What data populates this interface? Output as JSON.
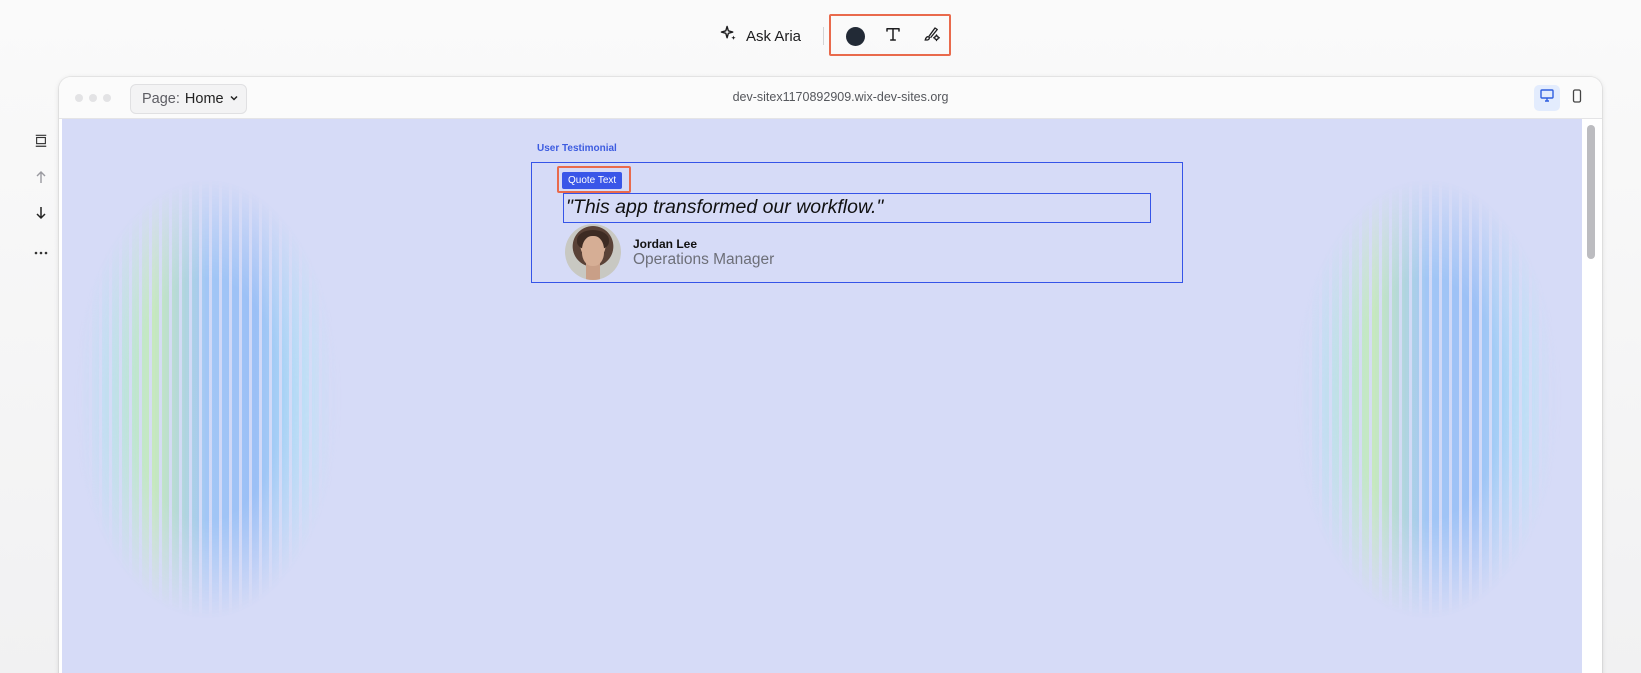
{
  "toolbar": {
    "ask_label": "Ask Aria",
    "tools": [
      {
        "name": "color-picker",
        "icon": "color-dot-icon",
        "color": "#222a36"
      },
      {
        "name": "text-format",
        "icon": "text-icon"
      },
      {
        "name": "design-settings",
        "icon": "brush-settings-icon"
      }
    ]
  },
  "left_rail": {
    "items": [
      {
        "icon": "layout-icon"
      },
      {
        "icon": "arrow-up-icon"
      },
      {
        "icon": "arrow-down-icon"
      },
      {
        "icon": "more-icon"
      }
    ]
  },
  "browser": {
    "page_prefix": "Page:",
    "page_name": "Home",
    "url": "dev-sitex1170892909.wix-dev-sites.org",
    "devices": [
      {
        "icon": "desktop-icon",
        "active": true
      },
      {
        "icon": "mobile-icon",
        "active": false
      }
    ]
  },
  "canvas": {
    "background": "#d6dbf7",
    "section_label": "User Testimonial",
    "selected_tag": "Quote Text",
    "quote": "\"This app transformed our workflow.\"",
    "person_name": "Jordan Lee",
    "person_role": "Operations Manager"
  },
  "colors": {
    "accent": "#3956e8",
    "highlight": "#e96a4c"
  }
}
